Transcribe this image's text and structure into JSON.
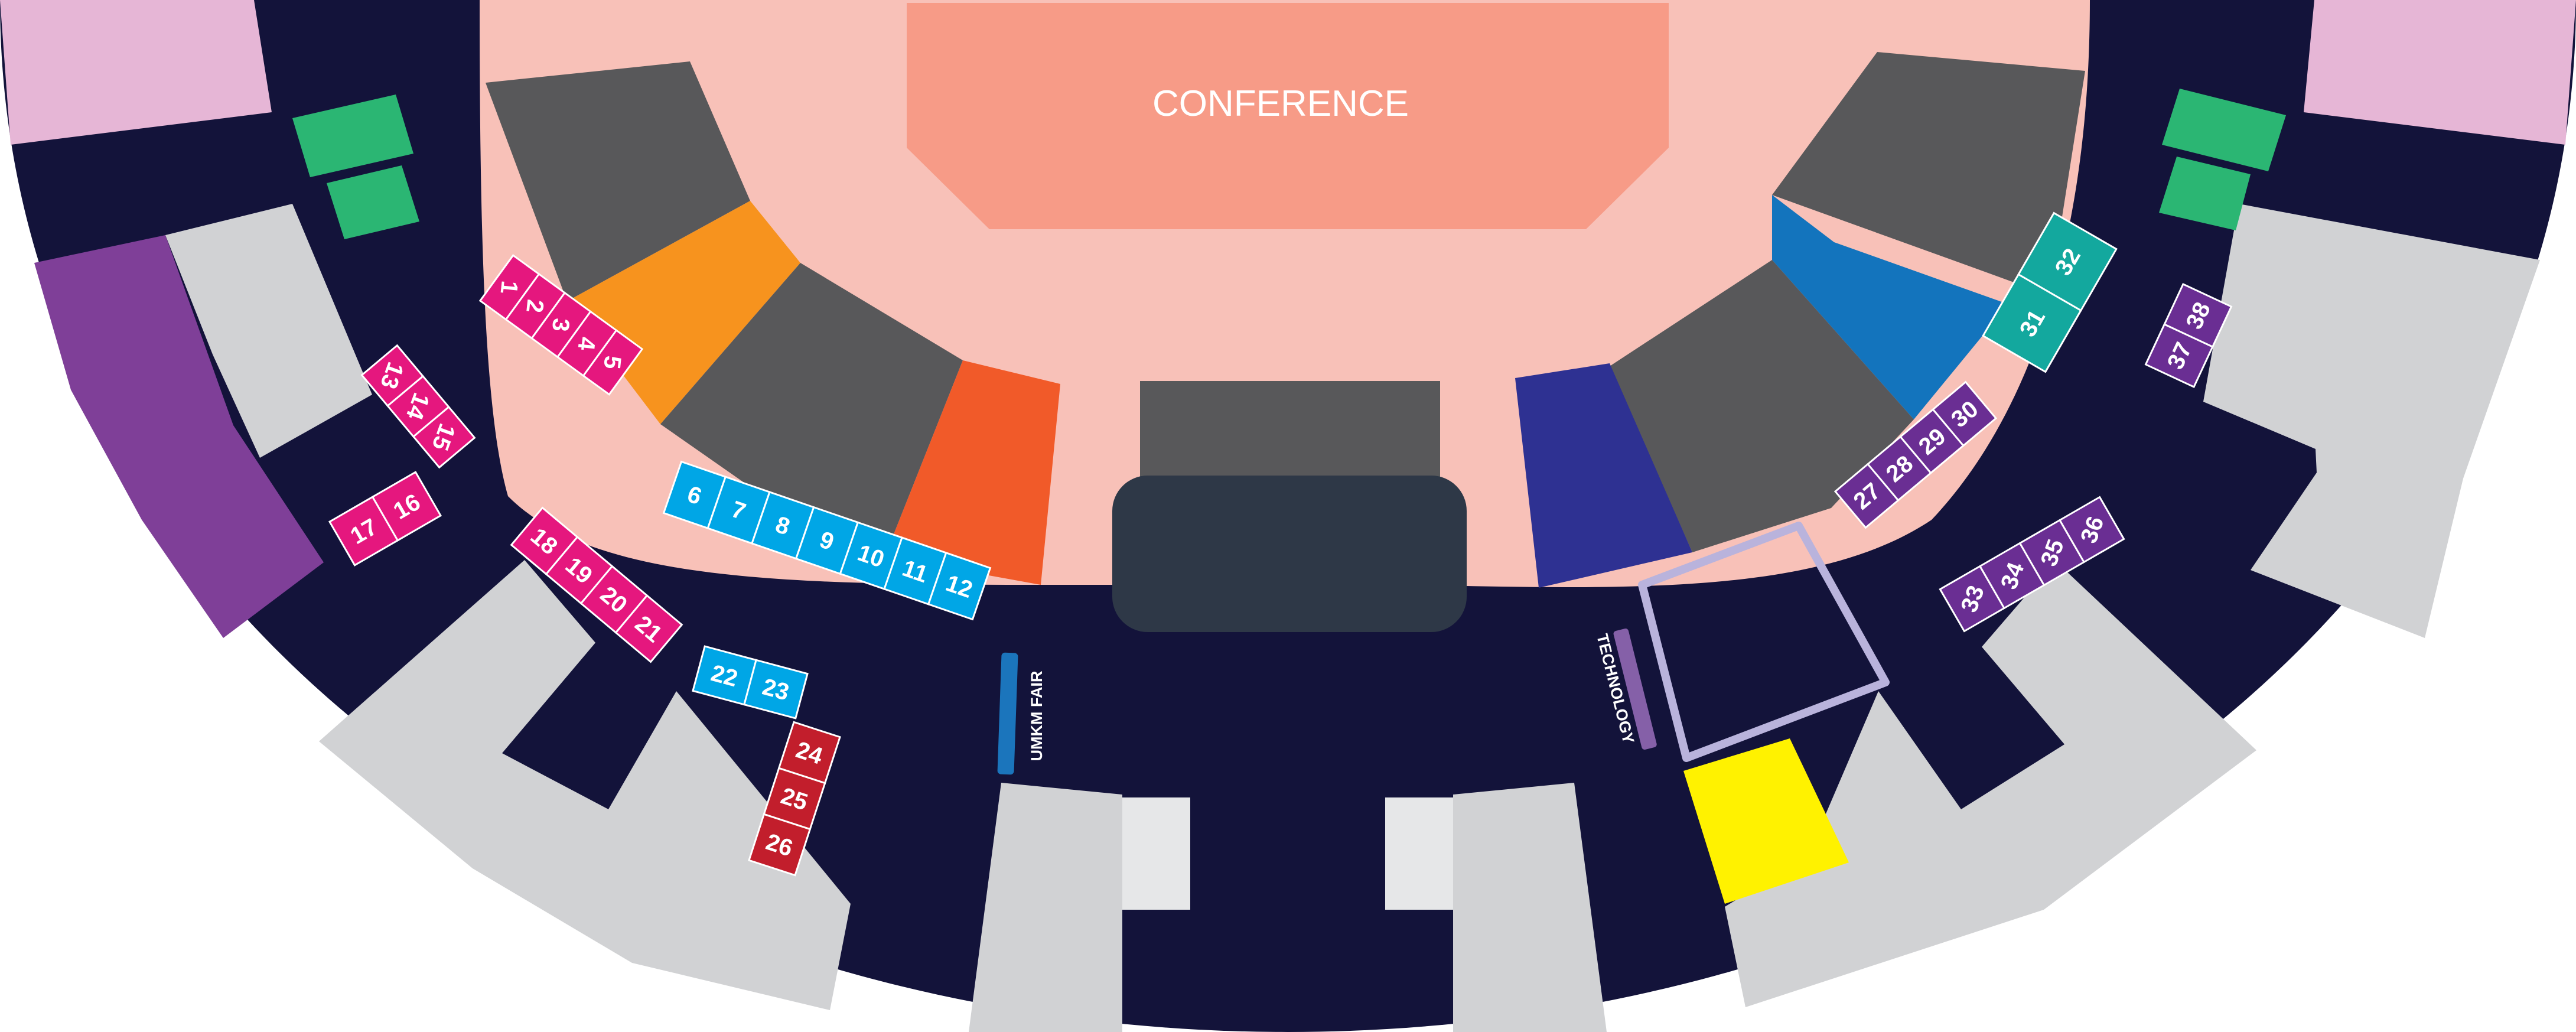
{
  "labels": {
    "conference": "CONFERENCE",
    "umkm_fair": "UMKM FAIR",
    "technology": "TECHNOLOGY"
  },
  "booths": {
    "group_1_5": [
      "1",
      "2",
      "3",
      "4",
      "5"
    ],
    "group_6_12": [
      "6",
      "7",
      "8",
      "9",
      "10",
      "11",
      "12"
    ],
    "group_13_15": [
      "13",
      "14",
      "15"
    ],
    "group_16_17": [
      "17",
      "16"
    ],
    "group_18_21": [
      "18",
      "19",
      "20",
      "21"
    ],
    "group_22_23": [
      "22",
      "23"
    ],
    "group_24_26": [
      "24",
      "25",
      "26"
    ],
    "group_27_30": [
      "27",
      "28",
      "29",
      "30"
    ],
    "group_31_32": [
      "31",
      "32"
    ],
    "group_33_36": [
      "33",
      "34",
      "35",
      "36"
    ],
    "group_37_38": [
      "37",
      "38"
    ]
  },
  "colors": {
    "background": "#13133a",
    "hall_floor": "#f8c1b8",
    "conference_stage": "#f79b87",
    "seating_dark": "#58585a",
    "stage_block": "#2e3847",
    "pink_booths": "#e5177e",
    "blue_booths": "#00a6e6",
    "red_booths": "#c21e2c",
    "purple_booths": "#6a2e93",
    "teal_booths": "#13a89e",
    "green_booths": "#2bb673",
    "grey_areas": "#d1d2d4",
    "light_pink_areas": "#e6b6d6",
    "orange_zone": "#f7931e",
    "red_orange_zone": "#f15a29",
    "medium_blue_zone": "#1374bd",
    "indigo_zone": "#2e3192",
    "yellow_zone": "#fff200",
    "violet_zone": "#7f3f98",
    "umkm_bar": "#1b75bc",
    "technology_bar": "#8560a8",
    "technology_outline": "#b9b3dc"
  }
}
